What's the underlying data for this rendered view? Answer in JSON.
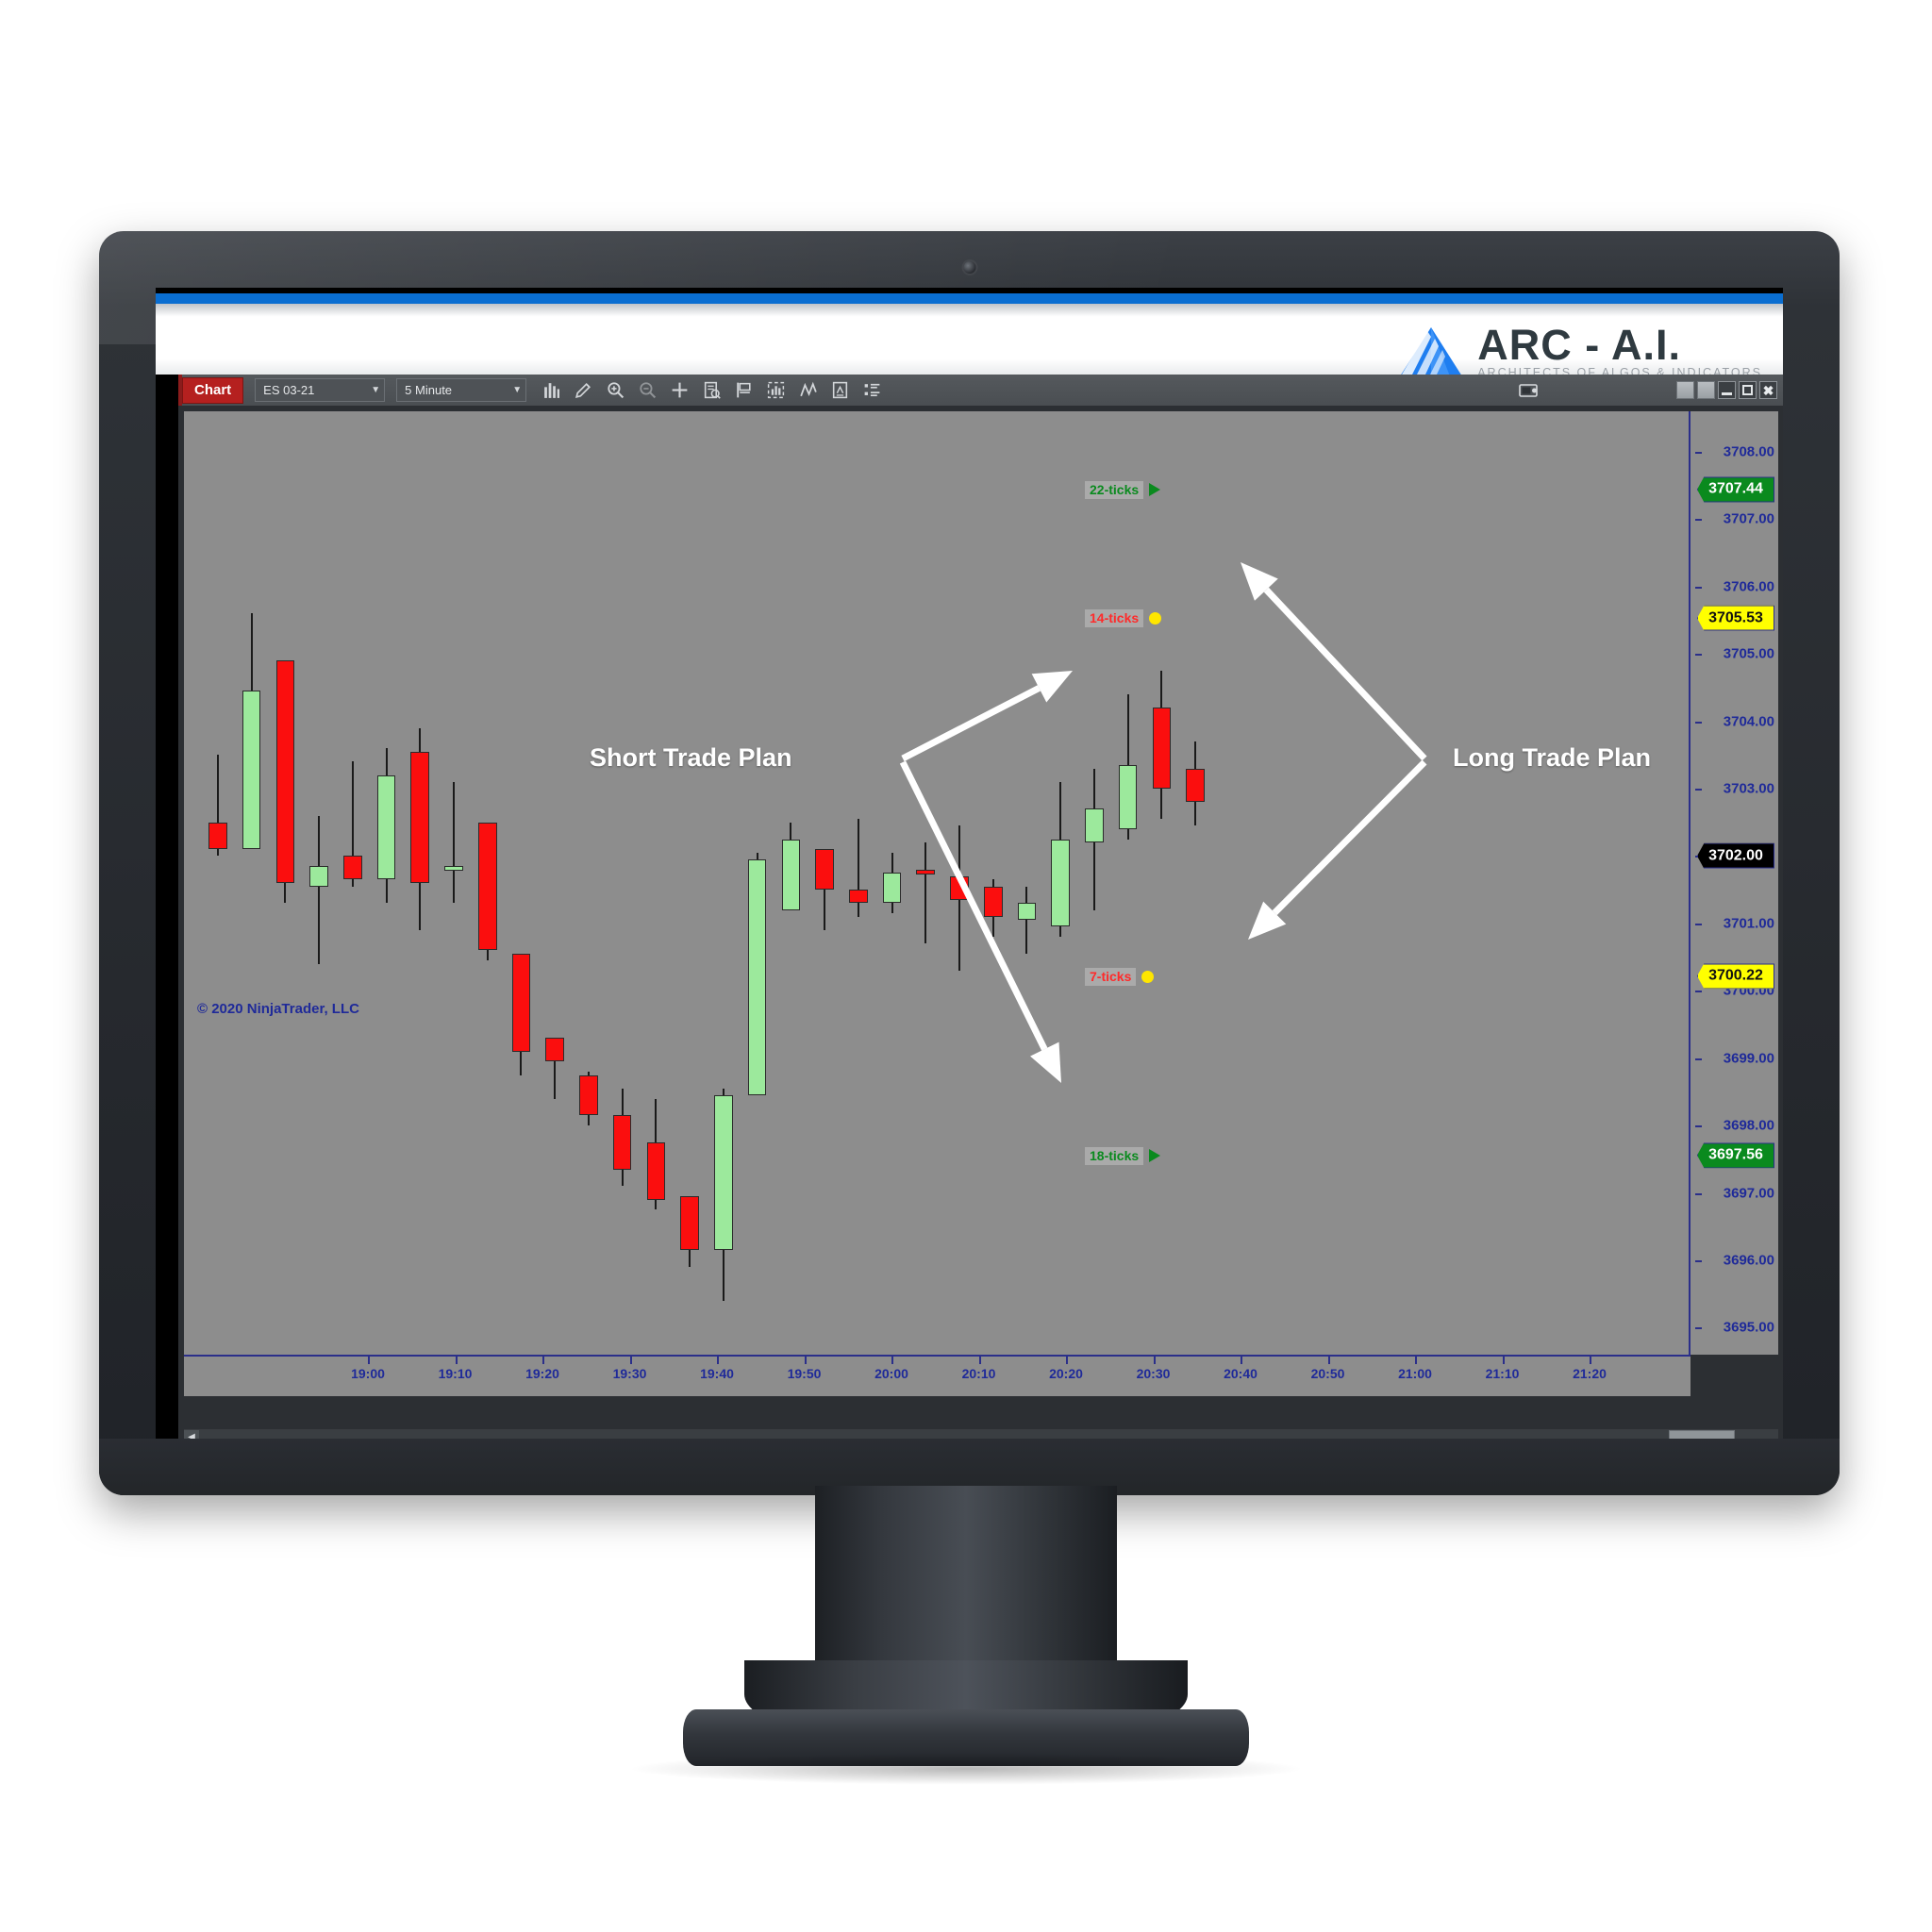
{
  "branding": {
    "logo_main": "ARC - A.I.",
    "logo_sub": "ARCHITECTS OF ALGOS & INDICATORS"
  },
  "toolbar": {
    "chart_button": "Chart",
    "instrument": "ES 03-21",
    "interval": "5 Minute",
    "icons": [
      "bar-chart-icon",
      "pencil-icon",
      "zoom-in-icon",
      "zoom-out-icon",
      "crosshair-icon",
      "data-box-icon",
      "flag-icon",
      "indicator-icon",
      "drawing-tool-icon",
      "properties-icon",
      "list-icon"
    ],
    "snapshot_icon": "snapshot-icon",
    "window_buttons": [
      "restore-button",
      "restore-button-2",
      "minimize-button",
      "maximize-button",
      "close-button"
    ],
    "close_label": "✖"
  },
  "chart_data": {
    "type": "candlestick",
    "title": "ES 03-21 5 Minute",
    "xlabel": "",
    "ylabel": "",
    "ylim": [
      3694.6,
      3708.6
    ],
    "grid": false,
    "y_ticks": [
      "3708.00",
      "3707.00",
      "3706.00",
      "3705.00",
      "3704.00",
      "3703.00",
      "3702.00",
      "3701.00",
      "3700.00",
      "3699.00",
      "3698.00",
      "3697.00",
      "3696.00",
      "3695.00"
    ],
    "x_ticks": [
      "19:00",
      "19:10",
      "19:20",
      "19:30",
      "19:40",
      "19:50",
      "20:00",
      "20:10",
      "20:20",
      "20:30",
      "20:40",
      "20:50",
      "21:00",
      "21:10",
      "21:20"
    ],
    "copyright": "© 2020 NinjaTrader, LLC",
    "price_markers": [
      {
        "name": "upper-target",
        "value": "3707.44",
        "style": "green"
      },
      {
        "name": "short-entry",
        "value": "3705.53",
        "style": "yellow"
      },
      {
        "name": "last-price",
        "value": "3702.00",
        "style": "black"
      },
      {
        "name": "long-entry",
        "value": "3700.22",
        "style": "yellow"
      },
      {
        "name": "lower-target",
        "value": "3697.56",
        "style": "green"
      }
    ],
    "tick_markers": [
      {
        "label": "22-ticks",
        "style": "green",
        "glyph": "triangle",
        "price": 3707.44
      },
      {
        "label": "14-ticks",
        "style": "red",
        "glyph": "dot",
        "price": 3705.53
      },
      {
        "label": "7-ticks",
        "style": "red",
        "glyph": "dot",
        "price": 3700.22
      },
      {
        "label": "18-ticks",
        "style": "green",
        "glyph": "triangle",
        "price": 3697.56
      }
    ],
    "candles": [
      {
        "t": "18:55",
        "o": 3702.5,
        "h": 3703.5,
        "l": 3702.0,
        "c": 3702.1
      },
      {
        "t": "19:00",
        "o": 3702.1,
        "h": 3705.6,
        "l": 3702.1,
        "c": 3704.45
      },
      {
        "t": "19:05",
        "o": 3704.9,
        "h": 3704.9,
        "l": 3701.3,
        "c": 3701.6
      },
      {
        "t": "19:10",
        "o": 3701.55,
        "h": 3702.6,
        "l": 3700.4,
        "c": 3701.85
      },
      {
        "t": "19:15",
        "o": 3702.0,
        "h": 3703.4,
        "l": 3701.55,
        "c": 3701.65
      },
      {
        "t": "19:20",
        "o": 3701.65,
        "h": 3703.6,
        "l": 3701.3,
        "c": 3703.2
      },
      {
        "t": "19:25",
        "o": 3703.55,
        "h": 3703.9,
        "l": 3700.9,
        "c": 3701.6
      },
      {
        "t": "19:30",
        "o": 3701.85,
        "h": 3703.1,
        "l": 3701.3,
        "c": 3701.85
      },
      {
        "t": "19:35",
        "o": 3702.5,
        "h": 3702.5,
        "l": 3700.45,
        "c": 3700.6
      },
      {
        "t": "19:40",
        "o": 3700.55,
        "h": 3700.55,
        "l": 3698.75,
        "c": 3699.1
      },
      {
        "t": "19:45",
        "o": 3699.3,
        "h": 3699.3,
        "l": 3698.4,
        "c": 3698.95
      },
      {
        "t": "19:50",
        "o": 3698.75,
        "h": 3698.8,
        "l": 3698.0,
        "c": 3698.15
      },
      {
        "t": "19:55",
        "o": 3698.15,
        "h": 3698.55,
        "l": 3697.1,
        "c": 3697.35
      },
      {
        "t": "20:00",
        "o": 3697.75,
        "h": 3698.4,
        "l": 3696.75,
        "c": 3696.9
      },
      {
        "t": "20:05",
        "o": 3696.95,
        "h": 3696.95,
        "l": 3695.9,
        "c": 3696.15
      },
      {
        "t": "20:10",
        "o": 3696.15,
        "h": 3698.55,
        "l": 3695.4,
        "c": 3698.45
      },
      {
        "t": "20:15",
        "o": 3698.45,
        "h": 3702.05,
        "l": 3698.45,
        "c": 3701.95
      },
      {
        "t": "20:20",
        "o": 3701.2,
        "h": 3702.5,
        "l": 3701.2,
        "c": 3702.25
      },
      {
        "t": "20:25",
        "o": 3702.1,
        "h": 3702.1,
        "l": 3700.9,
        "c": 3701.5
      },
      {
        "t": "20:30",
        "o": 3701.5,
        "h": 3702.55,
        "l": 3701.1,
        "c": 3701.3
      },
      {
        "t": "20:35",
        "o": 3701.3,
        "h": 3702.05,
        "l": 3701.15,
        "c": 3701.75
      },
      {
        "t": "20:40",
        "o": 3701.8,
        "h": 3702.2,
        "l": 3700.7,
        "c": 3701.75
      },
      {
        "t": "20:45",
        "o": 3701.7,
        "h": 3702.45,
        "l": 3700.3,
        "c": 3701.35
      },
      {
        "t": "20:50",
        "o": 3701.55,
        "h": 3701.65,
        "l": 3700.8,
        "c": 3701.1
      },
      {
        "t": "20:55",
        "o": 3701.05,
        "h": 3701.55,
        "l": 3700.55,
        "c": 3701.3
      },
      {
        "t": "21:00",
        "o": 3700.95,
        "h": 3703.1,
        "l": 3700.8,
        "c": 3702.25
      },
      {
        "t": "21:05",
        "o": 3702.2,
        "h": 3703.3,
        "l": 3701.2,
        "c": 3702.7
      },
      {
        "t": "21:10",
        "o": 3702.4,
        "h": 3704.4,
        "l": 3702.25,
        "c": 3703.35
      },
      {
        "t": "21:15",
        "o": 3704.2,
        "h": 3704.75,
        "l": 3702.55,
        "c": 3703.0
      },
      {
        "t": "21:20",
        "o": 3703.3,
        "h": 3703.7,
        "l": 3702.45,
        "c": 3702.8
      }
    ]
  },
  "annotations": [
    {
      "name": "short-trade-plan-label",
      "text": "Short Trade Plan"
    },
    {
      "name": "long-trade-plan-label",
      "text": "Long Trade Plan"
    }
  ],
  "colors": {
    "accent_blue": "#0a6ed1",
    "up_candle": "#9ce99c",
    "down_candle": "#fb0e0e",
    "axis_text": "#1f2a99",
    "plot_bg": "#8d8d8d",
    "green_pill": "#0a8a1e",
    "yellow_pill": "#ffff00"
  }
}
